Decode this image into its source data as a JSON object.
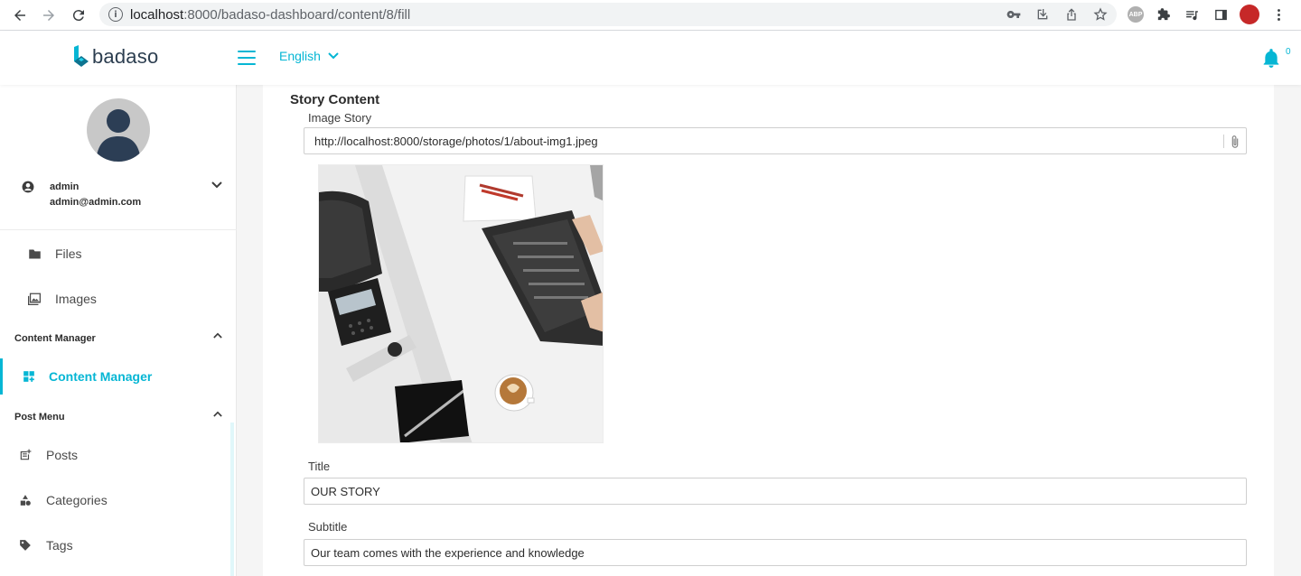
{
  "browser": {
    "url_host": "localhost",
    "url_path": ":8000/badaso-dashboard/content/8/fill",
    "info_icon": "i",
    "abp_label": "ABP"
  },
  "header": {
    "logo_text": "badaso",
    "language": "English",
    "notification_count": "0",
    "accent_color": "#06b6d4"
  },
  "sidebar": {
    "user": {
      "name": "admin",
      "email": "admin@admin.com"
    },
    "items_top": [
      {
        "label": "Files",
        "icon": "folder-icon"
      },
      {
        "label": "Images",
        "icon": "images-icon"
      }
    ],
    "section_content_manager": {
      "title": "Content Manager",
      "items": [
        {
          "label": "Content Manager",
          "icon": "dashboard-add-icon",
          "active": true
        }
      ]
    },
    "section_post_menu": {
      "title": "Post Menu",
      "items": [
        {
          "label": "Posts",
          "icon": "post-add-icon"
        },
        {
          "label": "Categories",
          "icon": "category-icon"
        },
        {
          "label": "Tags",
          "icon": "tag-icon"
        }
      ]
    }
  },
  "main": {
    "section_title": "Story Content",
    "image_story": {
      "label": "Image Story",
      "value": "http://localhost:8000/storage/photos/1/about-img1.jpeg"
    },
    "title_field": {
      "label": "Title",
      "value": "OUR STORY"
    },
    "subtitle_field": {
      "label": "Subtitle",
      "value": "Our team comes with the experience and knowledge"
    }
  }
}
